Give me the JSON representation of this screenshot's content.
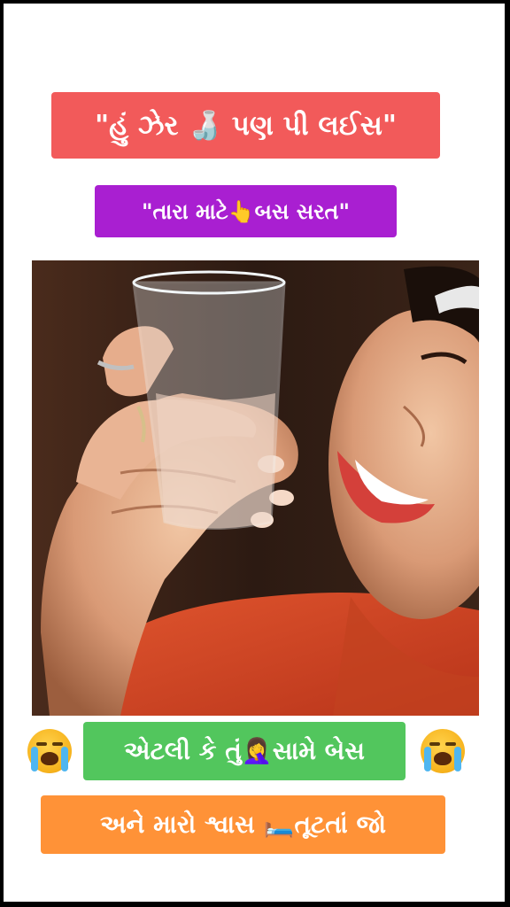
{
  "captions": {
    "line1": "\"હું ઝેર 🍶 પણ પી લઈસ\"",
    "line2": "\"તારા માટે👆બસ સરત\"",
    "line3": "એટલી કે તું🤦‍♀️સામે બેસ",
    "line4": "અને મારો શ્વાસ 🛏️તૂટતાં જો"
  },
  "colors": {
    "caption1_bg": "#f25a5a",
    "caption2_bg": "#a91fd1",
    "caption3_bg": "#52c65d",
    "caption4_bg": "#ff9237"
  },
  "icons": {
    "left": "loudly-crying-face-icon",
    "right": "loudly-crying-face-icon"
  }
}
